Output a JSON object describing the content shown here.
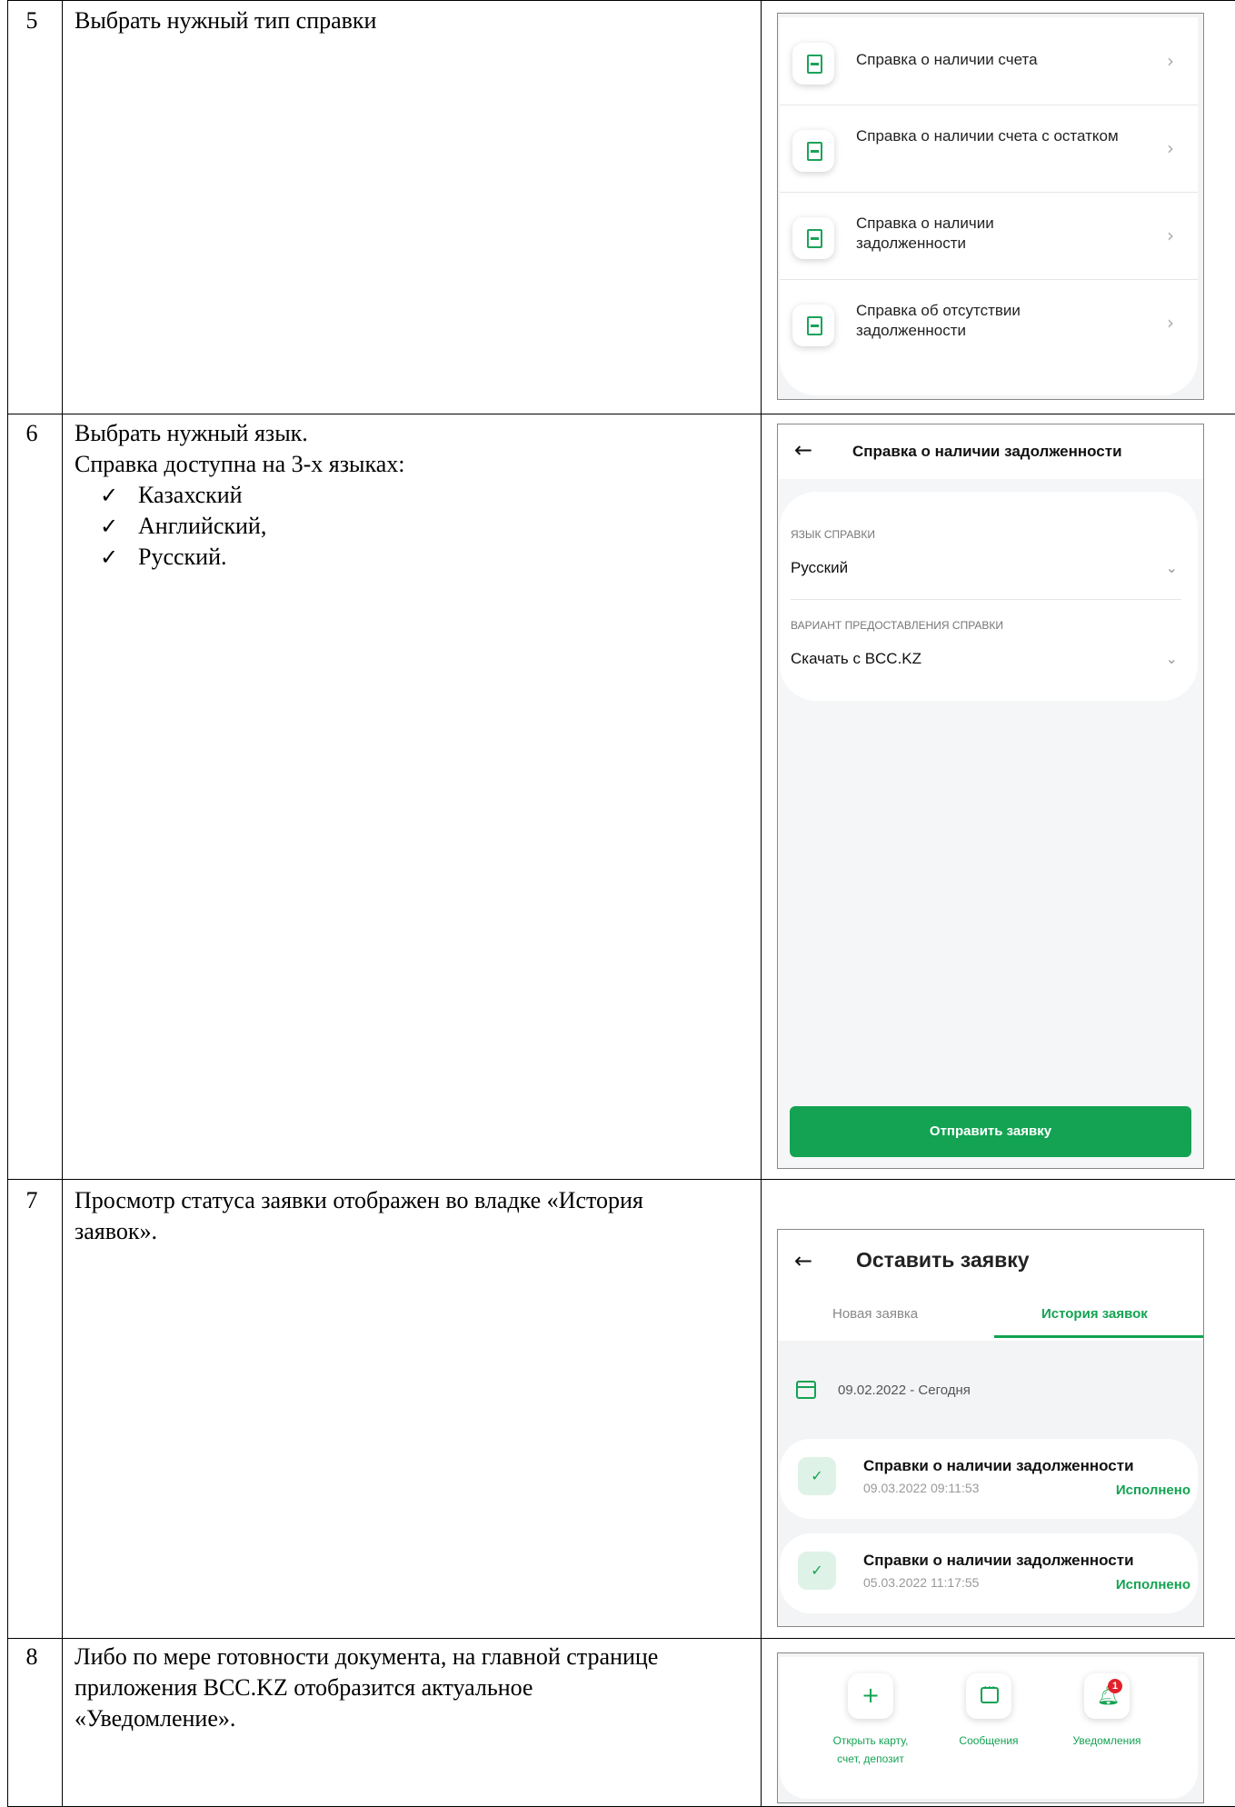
{
  "rows": [
    {
      "number": "5",
      "text": "Выбрать нужный тип справки",
      "items": [
        "Справка о наличии счета",
        "Справка о наличии счета с остатком",
        "Справка о наличии задолженности",
        "Справка об отсутствии задолженности"
      ]
    },
    {
      "number": "6",
      "text_lines": [
        "Выбрать нужный язык.",
        "Справка доступна на 3-х языках:"
      ],
      "languages": [
        "Казахский",
        "Английский,",
        "Русский."
      ],
      "screen_title": "Справка о наличии задолженности",
      "language_label": "ЯЗЫК СПРАВКИ",
      "language_value": "Русский",
      "variant_label": "ВАРИАНТ ПРЕДОСТАВЛЕНИЯ СПРАВКИ",
      "variant_value": "Скачать с BCC.KZ",
      "button": "Отправить заявку"
    },
    {
      "number": "7",
      "text": "Просмотр статуса заявки отображен во владке «История заявок».",
      "screen_title": "Оставить заявку",
      "tabs": [
        "Новая заявка",
        "История заявок"
      ],
      "date_range": "09.02.2022 - Сегодня",
      "requests": [
        {
          "title": "Справки о наличии задолженности",
          "datetime": "09.03.2022 09:11:53",
          "status": "Исполнено"
        },
        {
          "title": "Справки о наличии задолженности",
          "datetime": "05.03.2022 11:17:55",
          "status": "Исполнено"
        }
      ]
    },
    {
      "number": "8",
      "text": "Либо по мере готовности документа, на главной странице приложения BCC.KZ отобразится актуальное «Уведомление».",
      "actions": [
        {
          "label": "Открыть карту, счет, депозит",
          "icon": "plus-icon"
        },
        {
          "label": "Сообщения",
          "icon": "message-icon"
        },
        {
          "label": "Уведомления",
          "icon": "bell-icon",
          "badge": "1"
        }
      ]
    }
  ],
  "colors": {
    "accent": "#13a352",
    "badge": "#e0222a"
  }
}
